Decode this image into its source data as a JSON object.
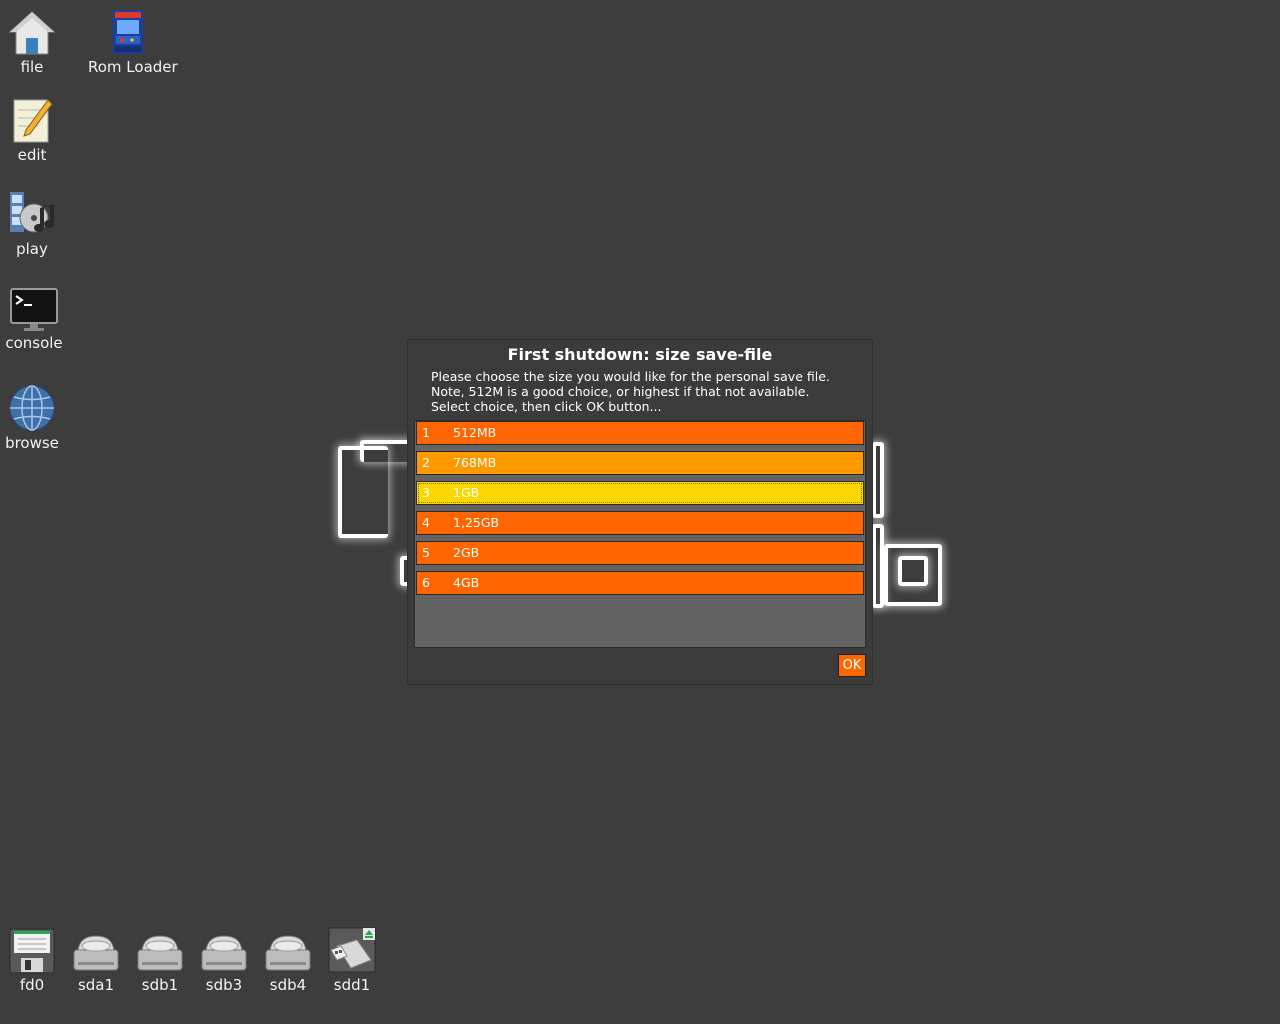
{
  "desktop": {
    "icons_left": [
      {
        "label": "file",
        "icon": "home-icon"
      },
      {
        "label": "Rom Loader",
        "icon": "arcade-cabinet-icon"
      },
      {
        "label": "edit",
        "icon": "notepad-pencil-icon"
      },
      {
        "label": "play",
        "icon": "multimedia-icon"
      },
      {
        "label": "console",
        "icon": "terminal-icon"
      },
      {
        "label": "browse",
        "icon": "globe-icon"
      }
    ],
    "drives": [
      {
        "label": "fd0",
        "icon": "floppy-icon"
      },
      {
        "label": "sda1",
        "icon": "hard-drive-icon"
      },
      {
        "label": "sdb1",
        "icon": "hard-drive-icon"
      },
      {
        "label": "sdb3",
        "icon": "hard-drive-icon"
      },
      {
        "label": "sdb4",
        "icon": "hard-drive-icon"
      },
      {
        "label": "sdd1",
        "icon": "usb-drive-icon"
      }
    ]
  },
  "dialog": {
    "title": "First shutdown: size save-file",
    "message_lines": [
      "Please choose the size you would like for the personal save file.",
      "Note, 512M is a good choice, or highest if that not available.",
      "Select choice, then click OK button..."
    ],
    "options": [
      {
        "num": "1",
        "label": "512MB",
        "color": "#ff6600"
      },
      {
        "num": "2",
        "label": "768MB",
        "color": "#ff9900"
      },
      {
        "num": "3",
        "label": "1GB",
        "color": "#ffd700",
        "selected": true
      },
      {
        "num": "4",
        "label": "1,25GB",
        "color": "#ff6600"
      },
      {
        "num": "5",
        "label": "2GB",
        "color": "#ff6600"
      },
      {
        "num": "6",
        "label": "4GB",
        "color": "#ff6600"
      }
    ],
    "ok_label": "OK"
  },
  "colors": {
    "desktop_bg": "#3d3d3d",
    "accent": "#ff6600"
  }
}
